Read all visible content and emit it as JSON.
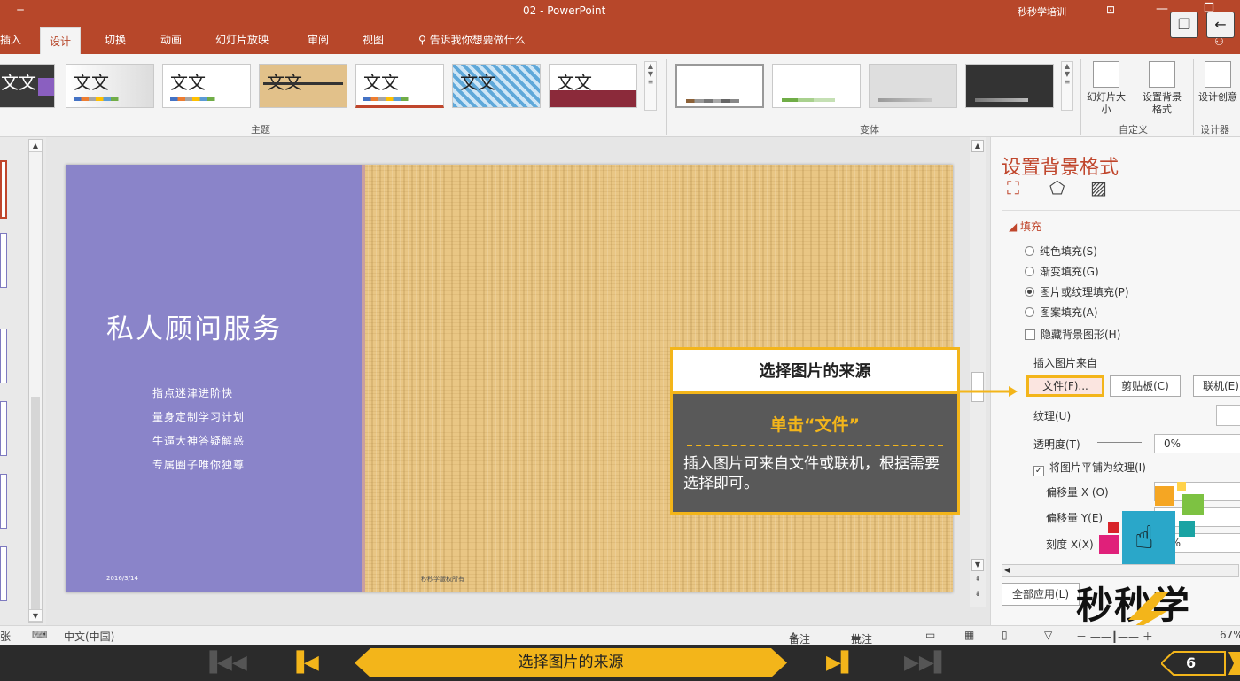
{
  "window": {
    "quick_access": "=",
    "document_title": "02 - PowerPoint",
    "account": "秒秒学培训"
  },
  "tabs": [
    "插入",
    "设计",
    "切换",
    "动画",
    "幻灯片放映",
    "审阅",
    "视图"
  ],
  "active_tab": "设计",
  "tell_me": "告诉我你想要做什么",
  "ribbon": {
    "themes_label": "主题",
    "variants_label": "变体",
    "theme_sample_text": "文文",
    "slide_size": "幻灯片大小",
    "bg_format": "设置背景格式",
    "customize_label": "自定义",
    "design_ideas": "设计创意",
    "designer_label": "设计器"
  },
  "slide": {
    "title": "私人顾问服务",
    "lines": [
      "指点迷津进阶快",
      "量身定制学习计划",
      "牛逼大神答疑解惑",
      "专属圈子唯你独尊"
    ],
    "date": "2016/3/14",
    "copyright": "秒秒学版权所有"
  },
  "pane": {
    "title": "设置背景格式",
    "section": "填充",
    "options": [
      {
        "label": "纯色填充(S)",
        "selected": false
      },
      {
        "label": "渐变填充(G)",
        "selected": false
      },
      {
        "label": "图片或纹理填充(P)",
        "selected": true
      },
      {
        "label": "图案填充(A)",
        "selected": false
      }
    ],
    "hide_bg": "隐藏背景图形(H)",
    "insert_from": "插入图片来自",
    "btn_file": "文件(F)...",
    "btn_clipboard": "剪贴板(C)",
    "btn_online": "联机(E)",
    "texture": "纹理(U)",
    "transparency": "透明度(T)",
    "transparency_value": "0%",
    "tile": "将图片平铺为纹理(I)",
    "offset_x": "偏移量 X (O)",
    "offset_y": "偏移量 Y(E)",
    "scale_x": "刻度 X(X)",
    "scale_value": "0%",
    "apply_all": "全部应用(L)"
  },
  "callout": {
    "heading": "选择图片的来源",
    "step": "单击“文件”",
    "desc": "插入图片可来自文件或联机，根据需要选择即可。"
  },
  "status": {
    "left_frag": "张",
    "language": "中文(中国)",
    "notes": "备注",
    "comments": "批注",
    "zoom": "67%"
  },
  "player": {
    "title": "选择图片的来源",
    "page": "6"
  },
  "logo": {
    "text": "秒秒学"
  },
  "colors": {
    "brand": "#b7472a",
    "highlight": "#f3b51a",
    "slide_purple": "#8a84c9",
    "slide_texture": "#e9c684"
  }
}
